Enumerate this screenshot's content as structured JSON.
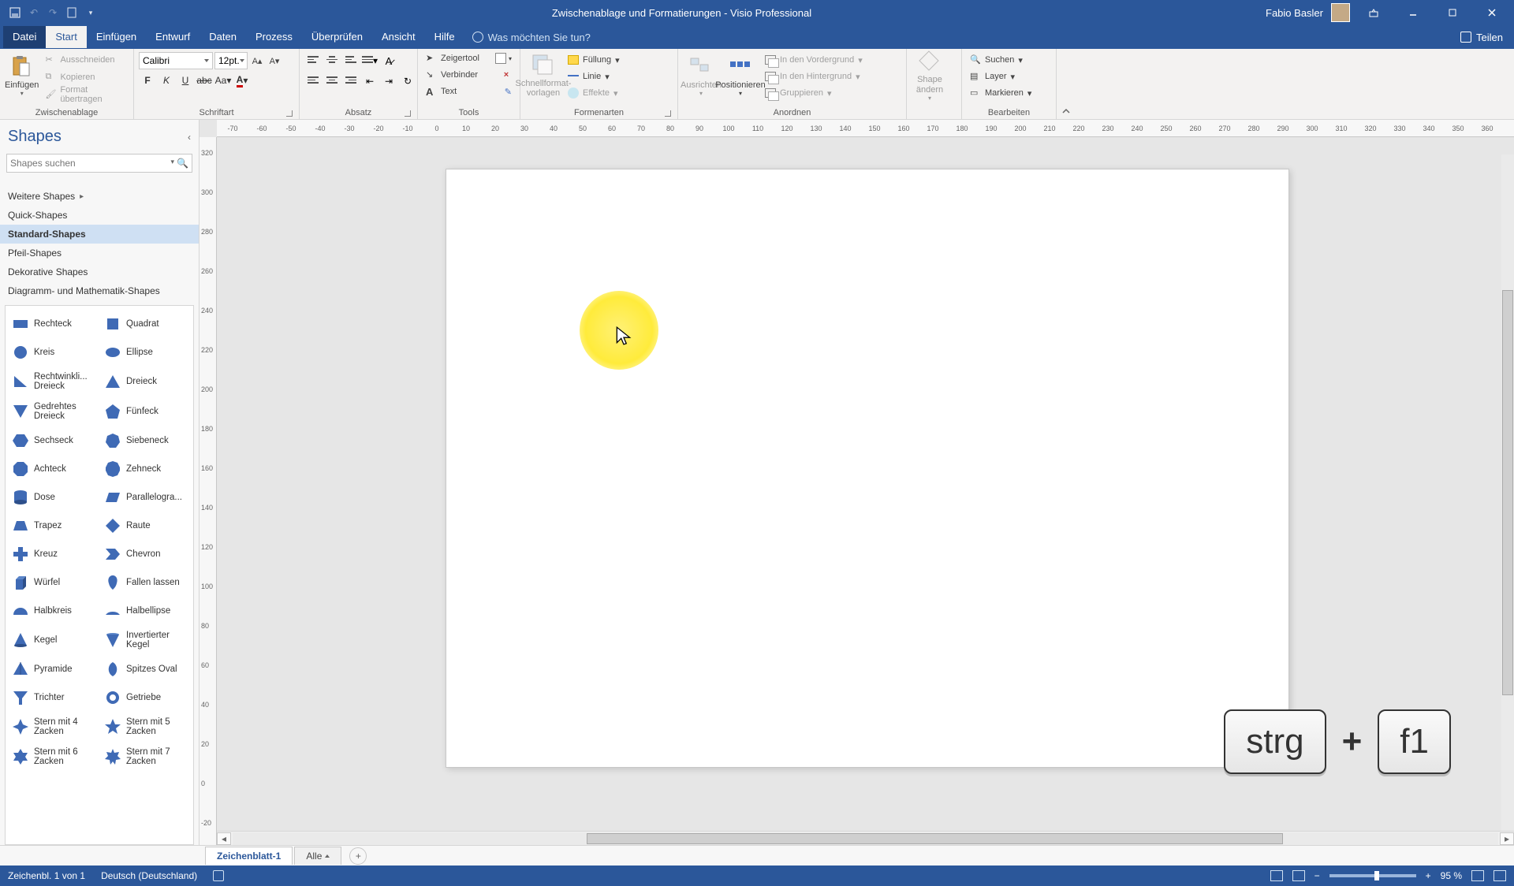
{
  "app": {
    "title": "Zwischenablage und Formatierungen  -  Visio Professional",
    "user": "Fabio Basler"
  },
  "menu": {
    "file": "Datei",
    "start": "Start",
    "einfuegen": "Einfügen",
    "entwurf": "Entwurf",
    "daten": "Daten",
    "prozess": "Prozess",
    "ueberpruefen": "Überprüfen",
    "ansicht": "Ansicht",
    "hilfe": "Hilfe",
    "tell_me": "Was möchten Sie tun?",
    "teilen": "Teilen"
  },
  "ribbon": {
    "zwischenablage": {
      "label": "Zwischenablage",
      "einfuegen": "Einfügen",
      "ausschneiden": "Ausschneiden",
      "kopieren": "Kopieren",
      "format": "Format übertragen"
    },
    "schrift": {
      "label": "Schriftart",
      "font": "Calibri",
      "size": "12pt."
    },
    "absatz": {
      "label": "Absatz"
    },
    "tools": {
      "label": "Tools",
      "zeigertool": "Zeigertool",
      "verbinder": "Verbinder",
      "text": "Text"
    },
    "formen": {
      "label": "Formenarten",
      "schnell": "Schnellformat-vorlagen",
      "fuellung": "Füllung",
      "linie": "Linie",
      "effekte": "Effekte"
    },
    "anordnen": {
      "label": "Anordnen",
      "ausrichten": "Ausrichten",
      "positionieren": "Positionieren",
      "vordergrund": "In den Vordergrund",
      "hintergrund": "In den Hintergrund",
      "gruppieren": "Gruppieren"
    },
    "shape_group": {
      "label": "Shape ändern",
      "shape": "Shape ändern"
    },
    "bearbeiten": {
      "label": "Bearbeiten",
      "suchen": "Suchen",
      "layer": "Layer",
      "markieren": "Markieren"
    }
  },
  "shapes_pane": {
    "title": "Shapes",
    "search_placeholder": "Shapes suchen",
    "cats": {
      "more": "Weitere Shapes",
      "quick": "Quick-Shapes",
      "standard": "Standard-Shapes",
      "pfeil": "Pfeil-Shapes",
      "dekorativ": "Dekorative Shapes",
      "diagramm": "Diagramm- und Mathematik-Shapes"
    },
    "shapes": [
      {
        "k": "rechteck",
        "l": "Rechteck"
      },
      {
        "k": "quadrat",
        "l": "Quadrat"
      },
      {
        "k": "kreis",
        "l": "Kreis"
      },
      {
        "k": "ellipse",
        "l": "Ellipse"
      },
      {
        "k": "rechtwdreieck",
        "l": "Rechtwinkli... Dreieck"
      },
      {
        "k": "dreieck",
        "l": "Dreieck"
      },
      {
        "k": "gedreht",
        "l": "Gedrehtes Dreieck"
      },
      {
        "k": "fuenfeck",
        "l": "Fünfeck"
      },
      {
        "k": "sechseck",
        "l": "Sechseck"
      },
      {
        "k": "siebeneck",
        "l": "Siebeneck"
      },
      {
        "k": "achteck",
        "l": "Achteck"
      },
      {
        "k": "zehneck",
        "l": "Zehneck"
      },
      {
        "k": "dose",
        "l": "Dose"
      },
      {
        "k": "parallelo",
        "l": "Parallelogra..."
      },
      {
        "k": "trapez",
        "l": "Trapez"
      },
      {
        "k": "raute",
        "l": "Raute"
      },
      {
        "k": "kreuz",
        "l": "Kreuz"
      },
      {
        "k": "chevron",
        "l": "Chevron"
      },
      {
        "k": "wuerfel",
        "l": "Würfel"
      },
      {
        "k": "fallen",
        "l": "Fallen lassen"
      },
      {
        "k": "halbkreis",
        "l": "Halbkreis"
      },
      {
        "k": "halbellipse",
        "l": "Halbellipse"
      },
      {
        "k": "kegel",
        "l": "Kegel"
      },
      {
        "k": "invkegel",
        "l": "Invertierter Kegel"
      },
      {
        "k": "pyramide",
        "l": "Pyramide"
      },
      {
        "k": "spitzoval",
        "l": "Spitzes Oval"
      },
      {
        "k": "trichter",
        "l": "Trichter"
      },
      {
        "k": "getriebe",
        "l": "Getriebe"
      },
      {
        "k": "stern4",
        "l": "Stern mit 4 Zacken"
      },
      {
        "k": "stern5",
        "l": "Stern mit 5 Zacken"
      },
      {
        "k": "stern6",
        "l": "Stern mit 6 Zacken"
      },
      {
        "k": "stern7",
        "l": "Stern mit 7 Zacken"
      }
    ]
  },
  "page_tabs": {
    "sheet1": "Zeichenblatt-1",
    "all": "Alle"
  },
  "status": {
    "page_info": "Zeichenbl. 1 von 1",
    "lang": "Deutsch (Deutschland)",
    "zoom": "95 %"
  },
  "overlay": {
    "key1": "strg",
    "plus": "+",
    "key2": "f1"
  },
  "hruler_ticks": [
    "-70",
    "-60",
    "-50",
    "-40",
    "-30",
    "-20",
    "-10",
    "0",
    "10",
    "20",
    "30",
    "40",
    "50",
    "60",
    "70",
    "80",
    "90",
    "100",
    "110",
    "120",
    "130",
    "140",
    "150",
    "160",
    "170",
    "180",
    "190",
    "200",
    "210",
    "220",
    "230",
    "240",
    "250",
    "260",
    "270",
    "280",
    "290",
    "300",
    "310",
    "320",
    "330",
    "340",
    "350",
    "360"
  ],
  "vruler_ticks": [
    "320",
    "300",
    "280",
    "260",
    "240",
    "220",
    "200",
    "180",
    "160",
    "140",
    "120",
    "100",
    "80",
    "60",
    "40",
    "20",
    "0",
    "-20"
  ]
}
